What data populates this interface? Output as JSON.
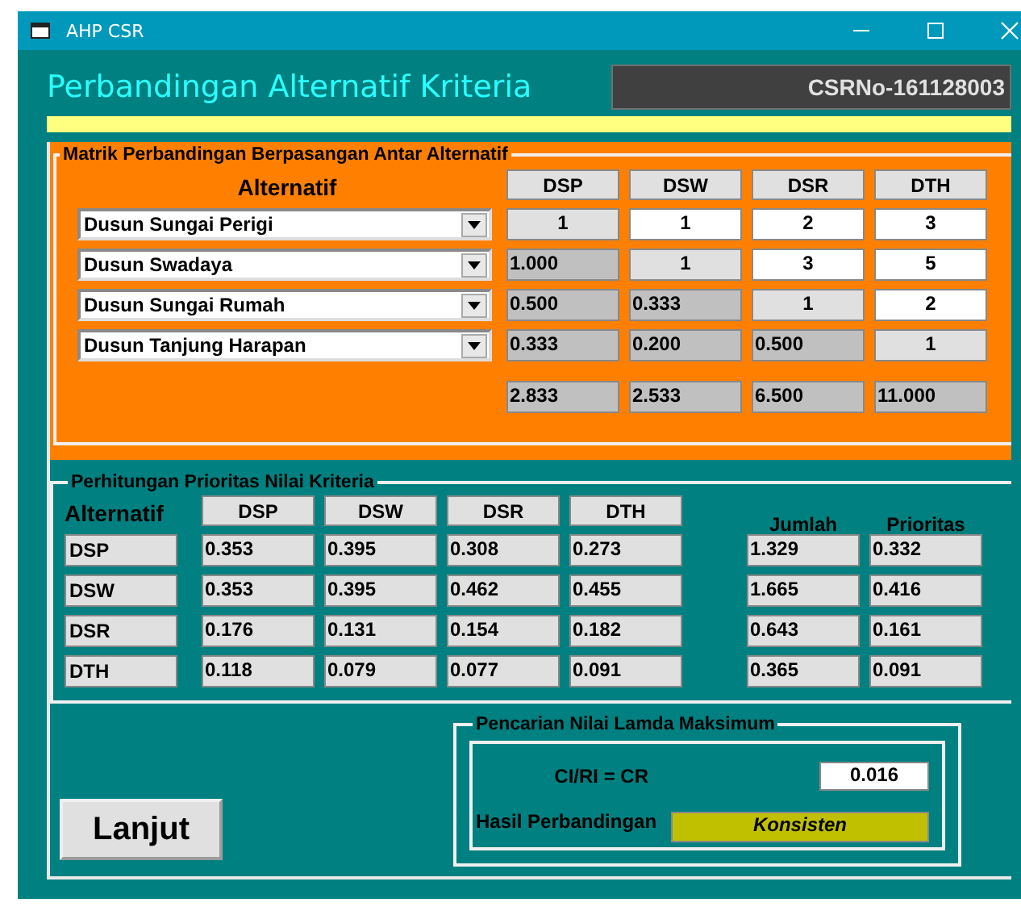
{
  "window": {
    "title": "AHP CSR"
  },
  "heading": "Perbandingan Alternatif Kriteria",
  "csr_no": "CSRNo-161128003",
  "pairwise_matrix": {
    "title": "Matrik Perbandingan Berpasangan Antar Alternatif",
    "row_header": "Alternatif",
    "columns": [
      "DSP",
      "DSW",
      "DSR",
      "DTH"
    ],
    "rows": [
      {
        "alternative": "Dusun Sungai Perigi",
        "cells": [
          {
            "value": "1",
            "kind": "diagonal"
          },
          {
            "value": "1",
            "kind": "input"
          },
          {
            "value": "2",
            "kind": "input"
          },
          {
            "value": "3",
            "kind": "input"
          }
        ]
      },
      {
        "alternative": "Dusun Swadaya",
        "cells": [
          {
            "value": "1.000",
            "kind": "computed"
          },
          {
            "value": "1",
            "kind": "diagonal"
          },
          {
            "value": "3",
            "kind": "input"
          },
          {
            "value": "5",
            "kind": "input"
          }
        ]
      },
      {
        "alternative": "Dusun Sungai Rumah",
        "cells": [
          {
            "value": "0.500",
            "kind": "computed"
          },
          {
            "value": "0.333",
            "kind": "computed"
          },
          {
            "value": "1",
            "kind": "diagonal"
          },
          {
            "value": "2",
            "kind": "input"
          }
        ]
      },
      {
        "alternative": "Dusun Tanjung Harapan",
        "cells": [
          {
            "value": "0.333",
            "kind": "computed"
          },
          {
            "value": "0.200",
            "kind": "computed"
          },
          {
            "value": "0.500",
            "kind": "computed"
          },
          {
            "value": "1",
            "kind": "diagonal"
          }
        ]
      }
    ],
    "totals": [
      "2.833",
      "2.533",
      "6.500",
      "11.000"
    ]
  },
  "priority": {
    "title": "Perhitungan Prioritas Nilai Kriteria",
    "row_header": "Alternatif",
    "columns": [
      "DSP",
      "DSW",
      "DSR",
      "DTH"
    ],
    "sum_header": "Jumlah",
    "priority_header": "Prioritas",
    "rows": [
      {
        "label": "DSP",
        "values": [
          "0.353",
          "0.395",
          "0.308",
          "0.273"
        ],
        "sum": "1.329",
        "priority": "0.332"
      },
      {
        "label": "DSW",
        "values": [
          "0.353",
          "0.395",
          "0.462",
          "0.455"
        ],
        "sum": "1.665",
        "priority": "0.416"
      },
      {
        "label": "DSR",
        "values": [
          "0.176",
          "0.131",
          "0.154",
          "0.182"
        ],
        "sum": "0.643",
        "priority": "0.161"
      },
      {
        "label": "DTH",
        "values": [
          "0.118",
          "0.079",
          "0.077",
          "0.091"
        ],
        "sum": "0.365",
        "priority": "0.091"
      }
    ]
  },
  "lambda": {
    "title": "Pencarian Nilai Lamda Maksimum",
    "cr_label": "CI/RI = CR",
    "cr_value": "0.016",
    "result_label": "Hasil Perbandingan",
    "result": "Konsisten"
  },
  "next_button": "Lanjut"
}
